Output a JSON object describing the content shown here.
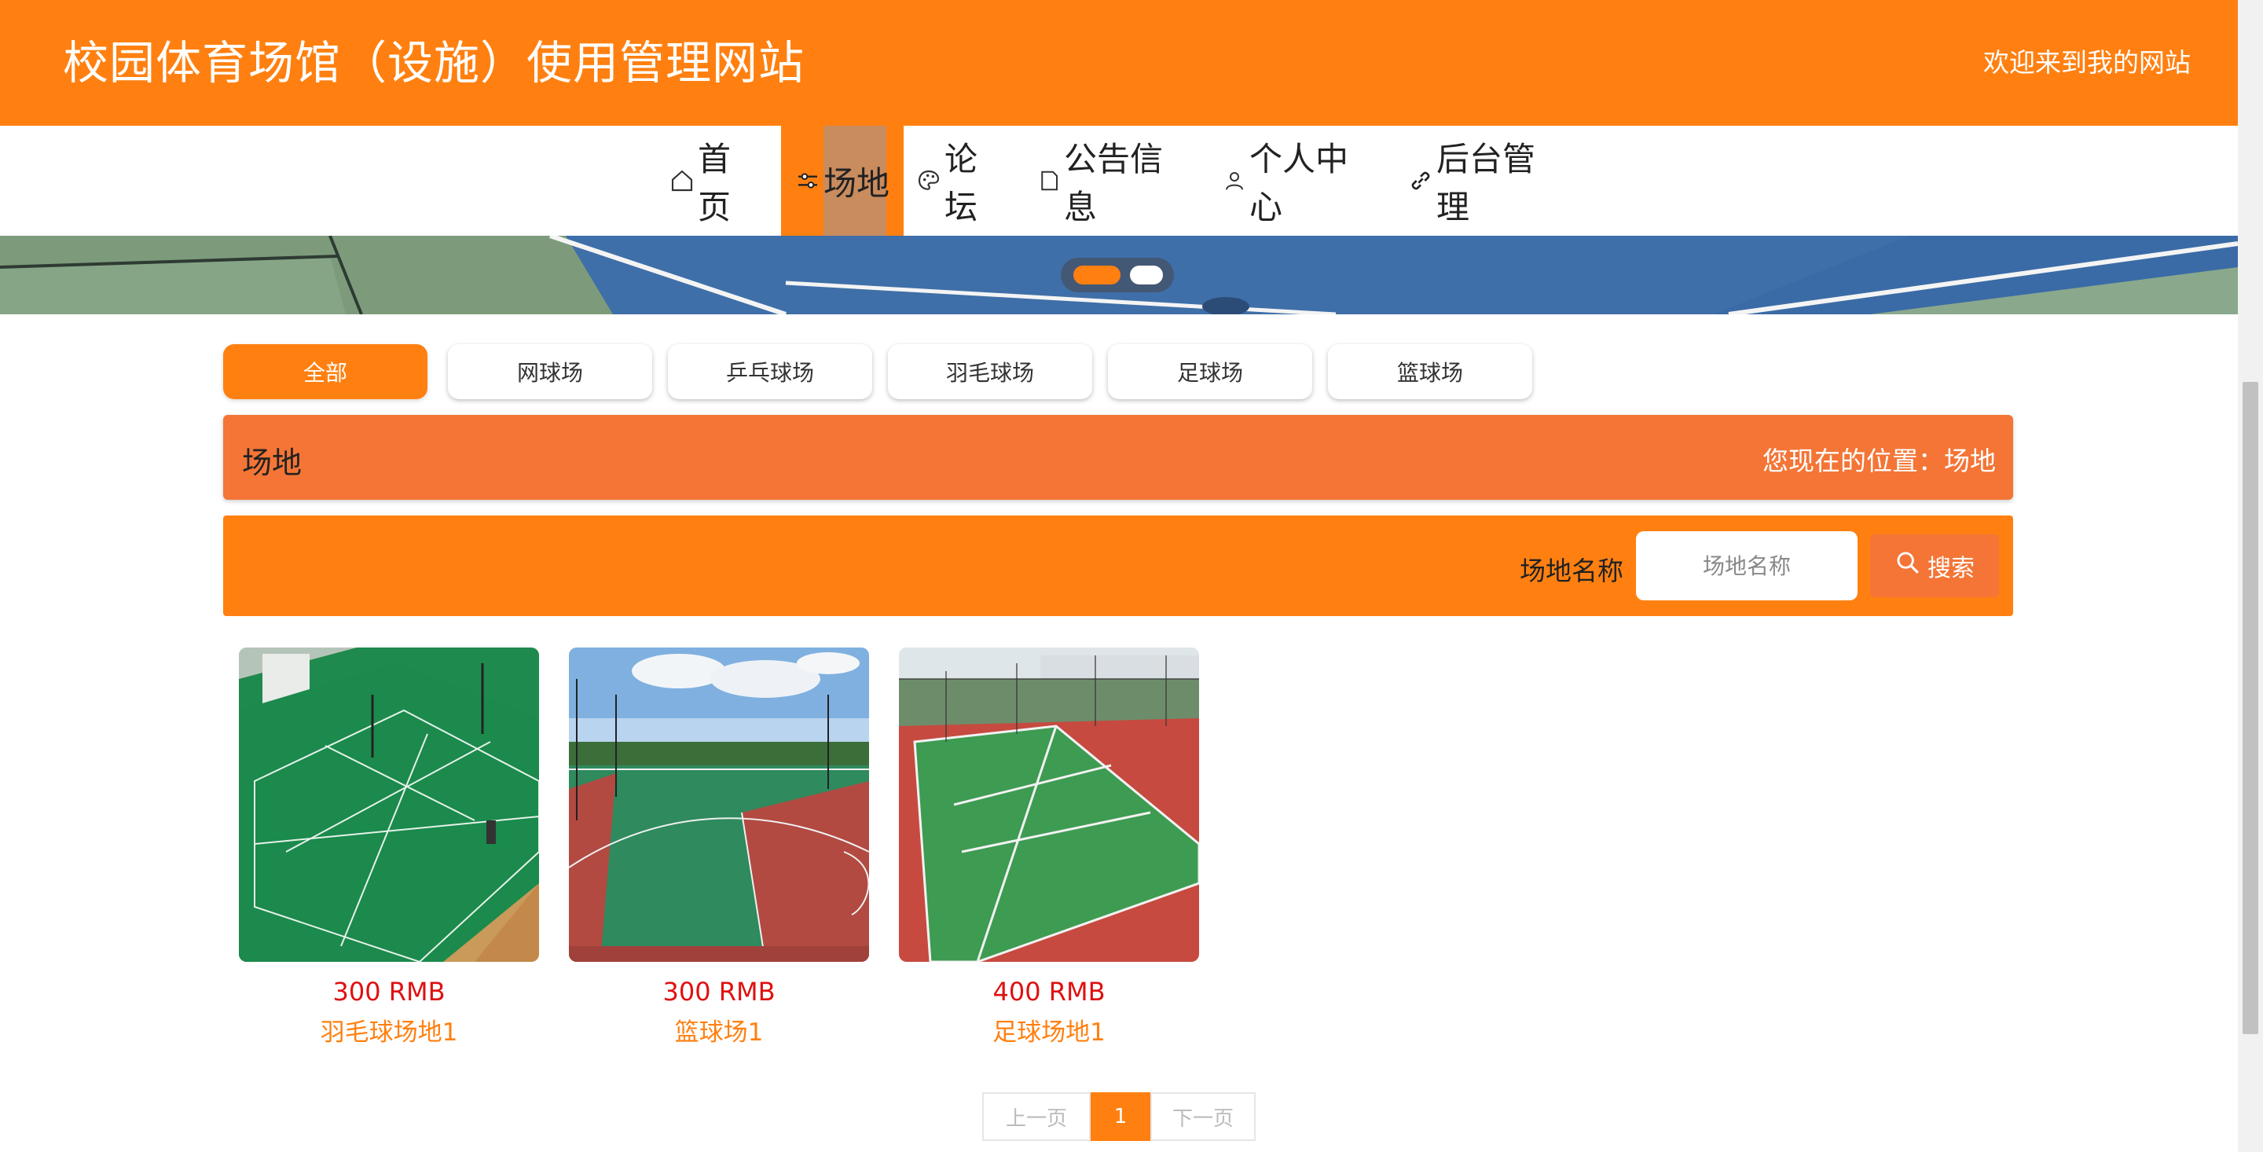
{
  "header": {
    "site_title": "校园体育场馆（设施）使用管理网站",
    "welcome": "欢迎来到我的网站"
  },
  "nav": {
    "items": [
      {
        "label": "首页",
        "icon": "home-icon"
      },
      {
        "label": "场地",
        "icon": "sliders-icon",
        "active": true
      },
      {
        "label": "论坛",
        "icon": "palette-icon"
      },
      {
        "label": "公告信息",
        "icon": "document-icon"
      },
      {
        "label": "个人中心",
        "icon": "user-icon"
      },
      {
        "label": "后台管理",
        "icon": "link-icon"
      }
    ]
  },
  "carousel": {
    "slides": 2,
    "active_index": 0
  },
  "categories": {
    "items": [
      "全部",
      "网球场",
      "乒乓球场",
      "羽毛球场",
      "足球场",
      "篮球场"
    ],
    "active": "全部"
  },
  "location_bar": {
    "title": "场地",
    "position": "您现在的位置：场地"
  },
  "search": {
    "label": "场地名称",
    "placeholder": "场地名称",
    "value": "",
    "button": "搜索"
  },
  "venues": [
    {
      "price": "300 RMB",
      "name": "羽毛球场地1",
      "image": "badminton-court-image"
    },
    {
      "price": "300 RMB",
      "name": "篮球场1",
      "image": "basketball-court-image"
    },
    {
      "price": "400 RMB",
      "name": "足球场地1",
      "image": "tennis-court-image"
    }
  ],
  "pagination": {
    "prev": "上一页",
    "current": "1",
    "next": "下一页"
  },
  "colors": {
    "primary": "#ff8011",
    "secondary": "#f47536",
    "price": "#e01010"
  }
}
